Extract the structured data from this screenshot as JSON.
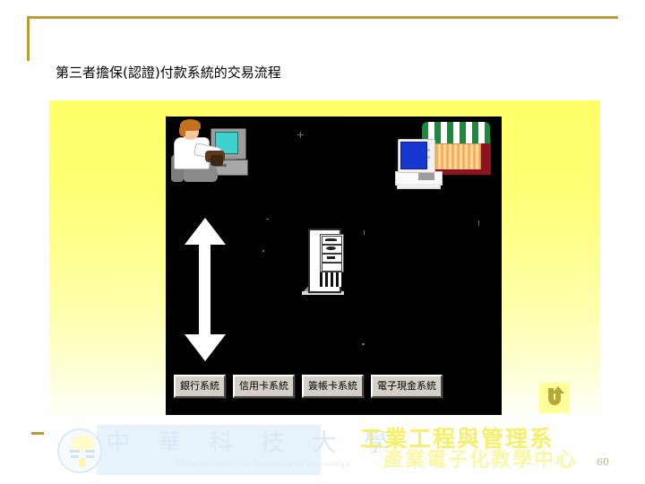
{
  "slide": {
    "title": "第三者擔保(認證)付款系統的交易流程",
    "number": "60"
  },
  "diagram": {
    "actors": {
      "customer": "customer-at-computer",
      "merchant": "merchant-storefront",
      "server": "central-server-tower",
      "flow_arrow": "vertical-double-arrow"
    },
    "buttons": [
      {
        "label": "銀行系統"
      },
      {
        "label": "信用卡系統"
      },
      {
        "label": "簽帳卡系統"
      },
      {
        "label": "電子現金系統"
      }
    ]
  },
  "return_button": {
    "icon": "return-arrow-icon",
    "background": "#ffff99",
    "arrow_color": "#b5a93c"
  },
  "footer": {
    "university_cn": "中 華 科 技 大 學",
    "university_en": "China University of Science and Technology",
    "department_line1": "工業工程與管理系",
    "department_line2": "產業電子化教學中心"
  },
  "theme": {
    "frame_gold": "#b89b3a",
    "panel_yellow_top": "#ffff66",
    "panel_yellow_bottom": "#ffffff",
    "stage_black": "#000000",
    "button_face": "#d4d0c8",
    "dept_yellow": "#f5f06a"
  }
}
